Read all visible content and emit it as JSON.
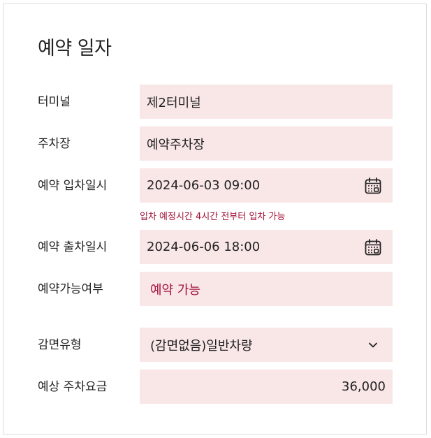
{
  "form": {
    "title": "예약 일자",
    "terminal": {
      "label": "터미널",
      "value": "제2터미널"
    },
    "parking_lot": {
      "label": "주차장",
      "value": "예약주차장"
    },
    "entry_datetime": {
      "label": "예약 입차일시",
      "value": "2024-06-03 09:00",
      "icon": "calendar-icon"
    },
    "entry_hint": "입차 예정시간 4시간 전부터 입차 가능",
    "exit_datetime": {
      "label": "예약 출차일시",
      "value": "2024-06-06 18:00",
      "icon": "calendar-icon"
    },
    "availability": {
      "label": "예약가능여부",
      "value": "예약 가능"
    },
    "discount_type": {
      "label": "감면유형",
      "value": "(감면없음)일반차량",
      "icon": "chevron-down-icon"
    },
    "estimated_fee": {
      "label": "예상 주차요금",
      "value": "36,000"
    }
  },
  "colors": {
    "field_bg": "#f9e6e7",
    "accent": "#a3123a",
    "border": "#dcdcdc"
  }
}
